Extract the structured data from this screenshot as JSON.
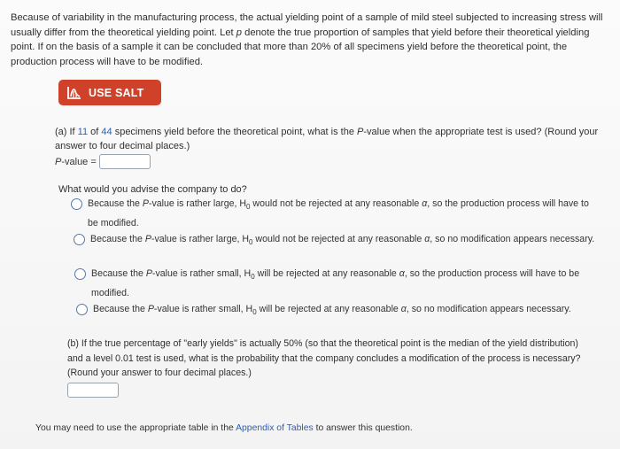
{
  "intro": {
    "part1": "Because of variability in the manufacturing process, the actual yielding point of a sample of mild steel subjected to increasing stress will usually differ from the theoretical yielding point. Let ",
    "var_p": "p",
    "part2": " denote the true proportion of samples that yield before their theoretical yielding point. If on the basis of a sample it can be concluded that more than 20% of all specimens yield before the theoretical point, the production process will have to be modified."
  },
  "salt_button": {
    "label": "USE SALT",
    "icon": "salt-chart-icon"
  },
  "part_a": {
    "prefix": "(a) If ",
    "n_yield": "11",
    "of": " of ",
    "n_total": "44",
    "middle": " specimens yield before the theoretical point, what is the ",
    "p_italic": "P",
    "suffix": "-value when the appropriate test is used? (Round your answer to four decimal places.)",
    "pvalue_label_italic": "P",
    "pvalue_label_rest": "-value =",
    "pvalue_value": ""
  },
  "advise": {
    "question": "What would you advise the company to do?",
    "options": [
      {
        "a": "Because the ",
        "b": "P",
        "c": "-value is rather large, H",
        "d": "0",
        "e": " would not be rejected at any reasonable ",
        "f": "α",
        "g": ", so the production process will have to be modified."
      },
      {
        "a": "Because the ",
        "b": "P",
        "c": "-value is rather large, H",
        "d": "0",
        "e": " would not be rejected at any reasonable ",
        "f": "α",
        "g": ", so no modification appears necessary."
      },
      {
        "a": "Because the ",
        "b": "P",
        "c": "-value is rather small, H",
        "d": "0",
        "e": " will be rejected at any reasonable ",
        "f": "α",
        "g": ", so the production process will have to be modified."
      },
      {
        "a": "Because the ",
        "b": "P",
        "c": "-value is rather small, H",
        "d": "0",
        "e": " will be rejected at any reasonable ",
        "f": "α",
        "g": ", so no modification appears necessary."
      }
    ]
  },
  "part_b": {
    "text": "(b) If the true percentage of \"early yields\" is actually 50% (so that the theoretical point is the median of the yield distribution) and a level 0.01 test is used, what is the probability that the company concludes a modification of the process is necessary? (Round your answer to four decimal places.)",
    "answer_value": ""
  },
  "footer": {
    "before": "You may need to use the appropriate table in the ",
    "link": "Appendix of Tables",
    "after": " to answer this question."
  },
  "colors": {
    "salt_button": "#cf4128",
    "link": "#2a5fb8",
    "radio_border": "#5877a6"
  }
}
